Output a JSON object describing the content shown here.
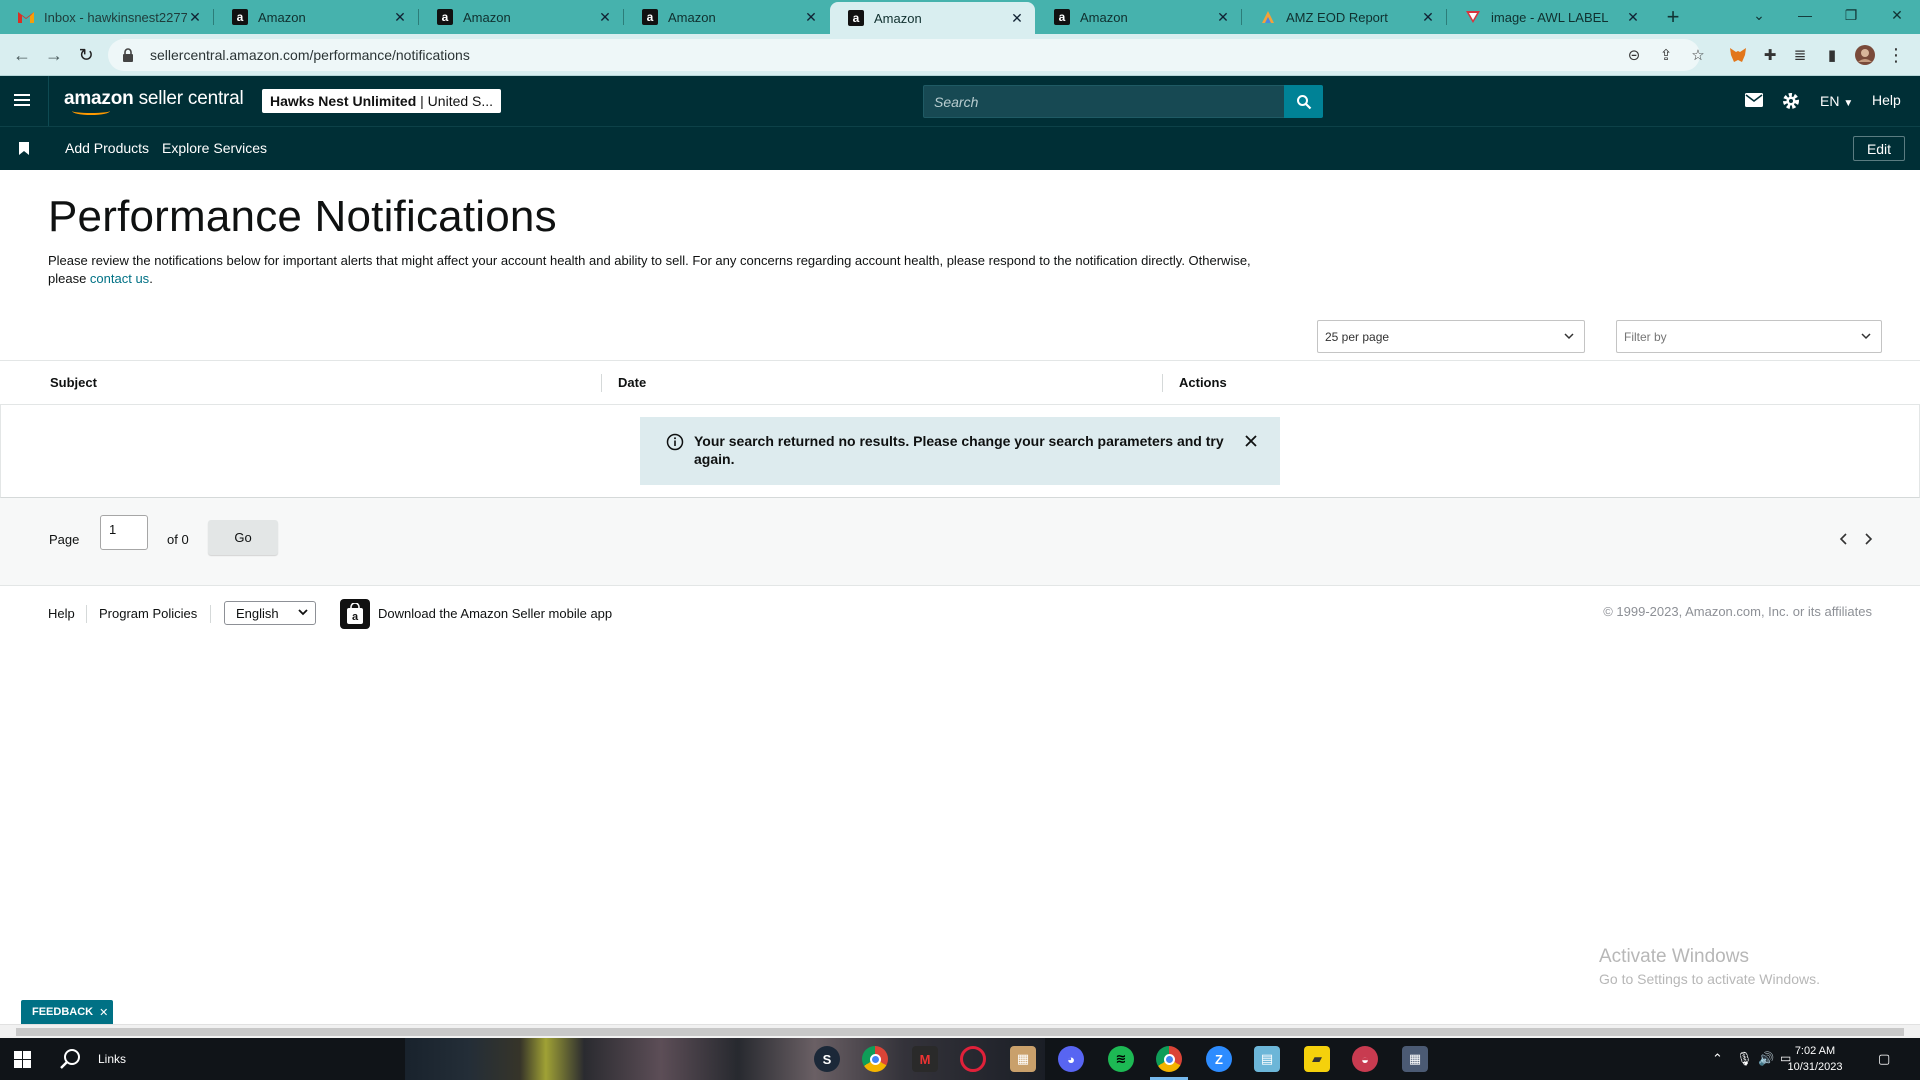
{
  "browser": {
    "tabs": [
      {
        "title": "Inbox - hawkinsnest2277@",
        "favicon": "gmail-icon",
        "active": false
      },
      {
        "title": "Amazon",
        "favicon": "amazon-icon",
        "active": false
      },
      {
        "title": "Amazon",
        "favicon": "amazon-icon",
        "active": false
      },
      {
        "title": "Amazon",
        "favicon": "amazon-icon",
        "active": false
      },
      {
        "title": "Amazon",
        "favicon": "amazon-icon",
        "active": true
      },
      {
        "title": "Amazon",
        "favicon": "amazon-icon",
        "active": false
      },
      {
        "title": "AMZ EOD Report",
        "favicon": "sheets-icon",
        "active": false
      },
      {
        "title": "image - AWL LABEL",
        "favicon": "label-icon",
        "active": false
      }
    ],
    "url": "sellercentral.amazon.com/performance/notifications",
    "colors": {
      "tab_strip": "#46b2ad",
      "toolbar": "#d9eef0"
    }
  },
  "header": {
    "logo_text_bold": "amazon",
    "logo_text": " seller central",
    "account_name": "Hawks Nest Unlimited",
    "account_region": "| United S...",
    "search_placeholder": "Search",
    "language": "EN",
    "help": "Help",
    "colors": {
      "background": "#002f36",
      "accent": "#008296"
    }
  },
  "nav": {
    "links": [
      "Add Products",
      "Explore Services"
    ],
    "edit": "Edit"
  },
  "main": {
    "title": "Performance Notifications",
    "intro": "Please review the notifications below for important alerts that might affect your account health and ability to sell. For any concerns regarding account health, please respond to the notification directly. Otherwise, please ",
    "contact_link": "contact us",
    "intro_end": ".",
    "per_page": "25 per page",
    "filter_placeholder": "Filter by",
    "columns": [
      "Subject",
      "Date",
      "Actions"
    ],
    "alert": "Your search returned no results. Please change your search parameters and try again."
  },
  "pager": {
    "page_label": "Page",
    "page_value": "1",
    "of_label": "of 0",
    "go": "Go"
  },
  "footer": {
    "help": "Help",
    "policies": "Program Policies",
    "language": "English",
    "download": "Download the Amazon Seller mobile app",
    "copyright": "© 1999-2023, Amazon.com, Inc. or its affiliates"
  },
  "watermark": {
    "line1": "Activate Windows",
    "line2": "Go to Settings to activate Windows."
  },
  "feedback": "FEEDBACK",
  "taskbar": {
    "search_label": "Links",
    "time": "7:02 AM",
    "date": "10/31/2023"
  }
}
